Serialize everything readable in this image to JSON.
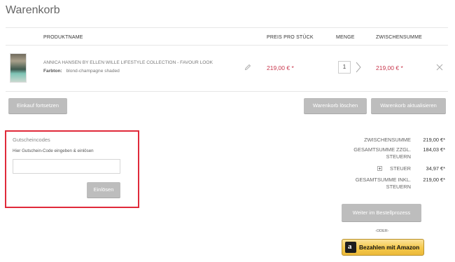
{
  "page": {
    "title": "Warenkorb"
  },
  "table": {
    "headers": {
      "product": "PRODUKTNAME",
      "price": "PREIS PRO STÜCK",
      "quantity": "MENGE",
      "subtotal": "ZWISCHENSUMME"
    }
  },
  "item": {
    "name": "ANNICA HANSEN BY ELLEN WILLE LIFESTYLE COLLECTION - FAVOUR LOOK",
    "attr_label": "Farbton:",
    "attr_value": "blond-champagne shaded",
    "unit_price": "219,00 € *",
    "quantity": "1",
    "subtotal": "219,00 € *",
    "image_icon": "product-thumbnail",
    "edit_icon": "pencil-icon",
    "remove_icon": "close-icon"
  },
  "actions": {
    "continue_shopping": "Einkauf fortsetzen",
    "clear_cart": "Warenkorb löschen",
    "update_cart": "Warenkorb aktualisieren"
  },
  "coupon": {
    "title": "Gutscheincodes",
    "hint": "Hier Gutschein-Code eingeben & einlösen",
    "input_value": "",
    "input_placeholder": "",
    "redeem": "Einlösen",
    "highlight_color": "#e02a3a"
  },
  "summary": {
    "subtotal_label": "ZWISCHENSUMME",
    "subtotal_value": "219,00 €*",
    "total_excl_label": "GESAMTSUMME ZZGL. STEUERN",
    "total_excl_value": "184,03 €*",
    "tax_label": "STEUER",
    "tax_value": "34,97 €*",
    "total_incl_label": "GESAMTSUMME INKL. STEUERN",
    "total_incl_value": "219,00 €*"
  },
  "checkout": {
    "proceed": "Weiter im Bestellprozess",
    "or": "-ODER-",
    "amazon": "Bezahlen mit Amazon",
    "amazon_logo_letter": "a"
  },
  "colors": {
    "price": "#c8374d",
    "button": "#bdbdbd",
    "amazon": "#f5c94a"
  }
}
